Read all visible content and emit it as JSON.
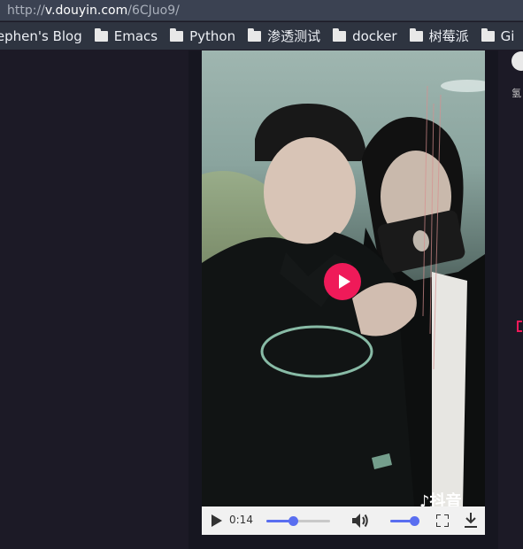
{
  "url_bar": {
    "prefix": "http://",
    "host": "v.douyin.com",
    "path": "/6CJuo9/"
  },
  "bookmarks": [
    {
      "label": "tephen's Blog",
      "folder": false
    },
    {
      "label": "Emacs",
      "folder": true
    },
    {
      "label": "Python",
      "folder": true
    },
    {
      "label": "渗透测试",
      "folder": true
    },
    {
      "label": "docker",
      "folder": true
    },
    {
      "label": "树莓派",
      "folder": true
    },
    {
      "label": "Gi",
      "folder": true
    }
  ],
  "video": {
    "watermark": "抖音",
    "time": "0:14",
    "progress": 0.42,
    "volume": 0.9
  },
  "side": {
    "text": "氢"
  },
  "colors": {
    "accent": "#5a6ef0",
    "play_button": "#ef1a59"
  }
}
